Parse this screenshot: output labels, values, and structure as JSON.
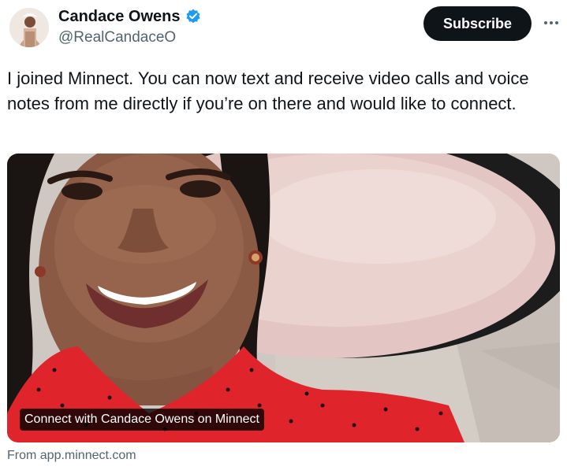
{
  "author": {
    "display_name": "Candace Owens",
    "handle": "@RealCandaceO",
    "verified": true
  },
  "actions": {
    "subscribe_label": "Subscribe",
    "more_icon": "more-horizontal-icon"
  },
  "tweet": {
    "text": "I joined Minnect. You can now text and receive video calls and voice notes from me directly if you’re on there and would like to connect."
  },
  "card": {
    "overlay_title": "Connect with Candace Owens on Minnect",
    "source": "From app.minnect.com"
  },
  "colors": {
    "text_primary": "#0f1419",
    "text_secondary": "#536471",
    "verified_blue": "#1d9bf0",
    "button_bg": "#0f1419"
  }
}
